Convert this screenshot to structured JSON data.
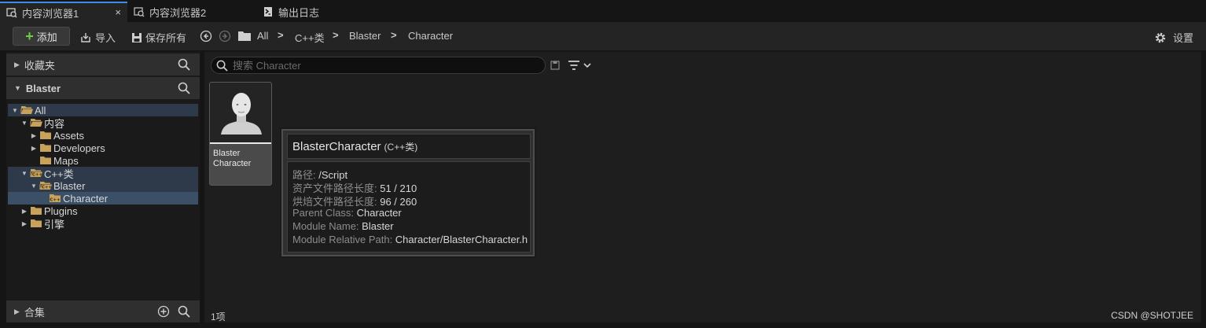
{
  "tabs": [
    {
      "label": "内容浏览器1",
      "active": true,
      "close": "×"
    },
    {
      "label": "内容浏览器2",
      "active": false
    },
    {
      "label": "输出日志",
      "active": false
    }
  ],
  "toolbar": {
    "add_label": "添加",
    "import_label": "导入",
    "save_all_label": "保存所有",
    "settings_label": "设置",
    "breadcrumbs": [
      "All",
      "C++类",
      "Blaster",
      "Character"
    ],
    "separator": ">"
  },
  "left_panel": {
    "favorites_label": "收藏夹",
    "project_label": "Blaster",
    "collections_label": "合集",
    "tree": [
      {
        "label": "All",
        "depth": 0,
        "expanded": true,
        "state": "highlight"
      },
      {
        "label": "内容",
        "depth": 1,
        "expanded": true
      },
      {
        "label": "Assets",
        "depth": 2,
        "expanded": false
      },
      {
        "label": "Developers",
        "depth": 2,
        "expanded": false
      },
      {
        "label": "Maps",
        "depth": 2,
        "leaf": true
      },
      {
        "label": "C++类",
        "depth": 1,
        "expanded": true,
        "state": "highlight"
      },
      {
        "label": "Blaster",
        "depth": 2,
        "expanded": true,
        "state": "highlight"
      },
      {
        "label": "Character",
        "depth": 3,
        "leaf": true,
        "state": "selected"
      },
      {
        "label": "Plugins",
        "depth": 1,
        "expanded": false
      },
      {
        "label": "引擎",
        "depth": 1,
        "expanded": false
      }
    ]
  },
  "content": {
    "search_placeholder": "搜索 Character",
    "asset_name": "Blaster Character",
    "item_count": "1项",
    "tooltip": {
      "title": "BlasterCharacter",
      "subtitle": "(C++类)",
      "lines": [
        {
          "k": "路径: ",
          "v": "/Script"
        },
        {
          "k": "资产文件路径长度: ",
          "v": "51 / 210"
        },
        {
          "k": "烘焙文件路径长度: ",
          "v": "96 / 260"
        },
        {
          "k": "Parent Class: ",
          "v": "Character"
        },
        {
          "k": "Module Name: ",
          "v": "Blaster"
        },
        {
          "k": "Module Relative Path: ",
          "v": "Character/BlasterCharacter.h"
        }
      ]
    }
  },
  "watermark": "CSDN @SHOTJEE",
  "colors": {
    "accent": "#3d8ee8",
    "add_plus": "#6fcf3f",
    "folder": "#c8a25a",
    "selected_row": "#3b4f67"
  }
}
